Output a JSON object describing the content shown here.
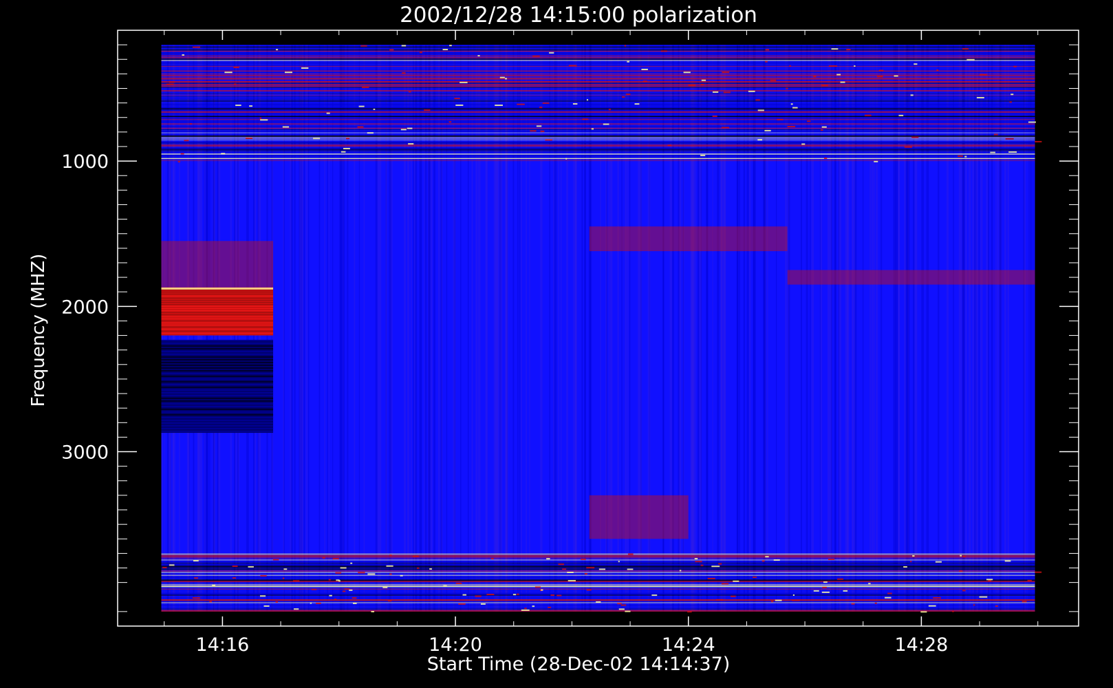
{
  "chart_data": {
    "type": "heatmap",
    "title": "2002/12/28 14:15:00 polarization",
    "xlabel": "Start Time (28-Dec-02 14:14:37)",
    "ylabel": "Frequency (MHZ)",
    "x_ticks": [
      {
        "label": "14:16",
        "minutes_after_1414": 2.0
      },
      {
        "label": "14:20",
        "minutes_after_1414": 6.0
      },
      {
        "label": "14:24",
        "minutes_after_1414": 10.0
      },
      {
        "label": "14:28",
        "minutes_after_1414": 14.0
      }
    ],
    "y_ticks": [
      {
        "label": "1000",
        "value": 1000
      },
      {
        "label": "2000",
        "value": 2000
      },
      {
        "label": "3000",
        "value": 3000
      }
    ],
    "x_range_minutes_after_1414": [
      0.2,
      16.7
    ],
    "ylim": [
      100,
      4200
    ],
    "data_x_range_minutes_after_1414": [
      0.95,
      15.95
    ],
    "data_y_range": [
      200,
      4100
    ],
    "y_axis_inverted": true,
    "colormap": {
      "low": "#000000",
      "mid_low": "#0000cc",
      "mid": "#1010ff",
      "mid_high": "#cc1010",
      "high": "#ffffa0"
    },
    "background_color": "#1010ff",
    "features": [
      {
        "label": "strong positive band",
        "x_from": 0.95,
        "x_to": 2.87,
        "y_from": 1870,
        "y_to": 2200,
        "level": "high"
      },
      {
        "label": "negative band",
        "x_from": 0.95,
        "x_to": 2.87,
        "y_from": 2230,
        "y_to": 2870,
        "level": "low"
      },
      {
        "label": "moderate band",
        "x_from": 0.95,
        "x_to": 2.87,
        "y_from": 1550,
        "y_to": 1870,
        "level": "mid_high"
      },
      {
        "label": "moderate band",
        "x_from": 8.3,
        "x_to": 11.7,
        "y_from": 1450,
        "y_to": 1620,
        "level": "mid_high"
      },
      {
        "label": "moderate band",
        "x_from": 8.3,
        "x_to": 10.0,
        "y_from": 3300,
        "y_to": 3600,
        "level": "mid_high"
      },
      {
        "label": "moderate band",
        "x_from": 11.7,
        "x_to": 15.95,
        "y_from": 1750,
        "y_to": 1850,
        "level": "mid_high"
      },
      {
        "label": "rfi lines",
        "x_from": 0.95,
        "x_to": 15.95,
        "y_from": 200,
        "y_to": 1000,
        "level": "mixed"
      },
      {
        "label": "rfi lines",
        "x_from": 0.95,
        "x_to": 15.95,
        "y_from": 3700,
        "y_to": 4100,
        "level": "mixed"
      }
    ],
    "grid": false,
    "legend": "none"
  }
}
